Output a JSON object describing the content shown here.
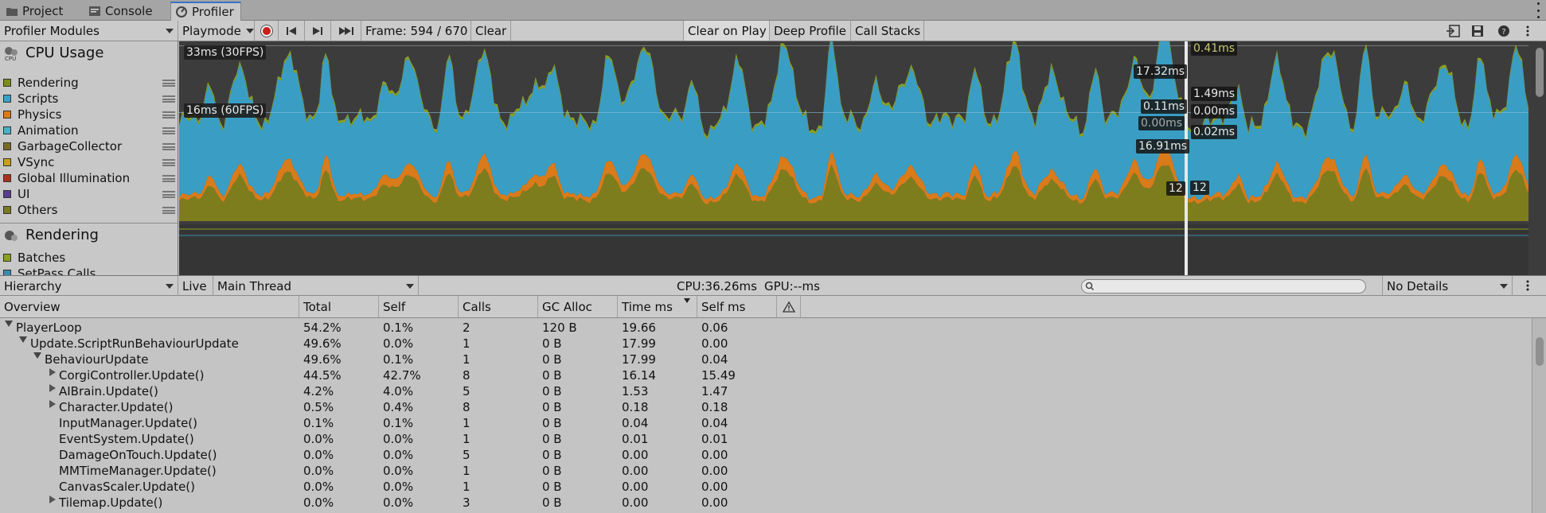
{
  "tabs": [
    {
      "label": "Project",
      "icon": "folder-icon"
    },
    {
      "label": "Console",
      "icon": "console-icon"
    },
    {
      "label": "Profiler",
      "icon": "profiler-icon",
      "active": true
    }
  ],
  "toolbar": {
    "modules_label": "Profiler Modules",
    "target_label": "Playmode",
    "frame_label": "Frame: 594 / 670",
    "clear_label": "Clear",
    "clear_on_play_label": "Clear on Play",
    "deep_profile_label": "Deep Profile",
    "call_stacks_label": "Call Stacks"
  },
  "modules": {
    "cpu": {
      "title": "CPU Usage",
      "legend": [
        {
          "label": "Rendering",
          "color": "#7d8c1e"
        },
        {
          "label": "Scripts",
          "color": "#3aa0c8"
        },
        {
          "label": "Physics",
          "color": "#d97b1a"
        },
        {
          "label": "Animation",
          "color": "#4ab0c8"
        },
        {
          "label": "GarbageCollector",
          "color": "#7a6a2a"
        },
        {
          "label": "VSync",
          "color": "#c8a018"
        },
        {
          "label": "Global Illumination",
          "color": "#a8321e"
        },
        {
          "label": "UI",
          "color": "#5a3c8c"
        },
        {
          "label": "Others",
          "color": "#7a7a22"
        }
      ]
    },
    "rendering": {
      "title": "Rendering",
      "legend": [
        {
          "label": "Batches",
          "color": "#8ca020"
        },
        {
          "label": "SetPass Calls",
          "color": "#3a8ab0"
        }
      ]
    }
  },
  "chart": {
    "line_30fps": "33ms (30FPS)",
    "line_60fps": "16ms (60FPS)",
    "readouts": {
      "top": "0.41ms",
      "scripts_left": "17.32ms",
      "scripts_right": "1.49ms",
      "physics_left": "0.11ms",
      "physics_right": "0.00ms",
      "gc_left": "0.00ms",
      "gc_right": "0.02ms",
      "rendering_left": "16.91ms",
      "batches_left": "12",
      "batches_right": "12"
    }
  },
  "status": {
    "view_label": "Hierarchy",
    "live_label": "Live",
    "thread_label": "Main Thread",
    "cpu_label": "CPU:36.26ms",
    "gpu_label": "GPU:--ms",
    "search_placeholder": "",
    "details_label": "No Details"
  },
  "table": {
    "columns": [
      "Overview",
      "Total",
      "Self",
      "Calls",
      "GC Alloc",
      "Time ms",
      "Self ms"
    ],
    "rows": [
      {
        "name": "PlayerLoop",
        "depth": 0,
        "fold": "open",
        "total": "54.2%",
        "self": "0.1%",
        "calls": "2",
        "gc": "120 B",
        "time": "19.66",
        "selfms": "0.06"
      },
      {
        "name": "Update.ScriptRunBehaviourUpdate",
        "depth": 1,
        "fold": "open",
        "total": "49.6%",
        "self": "0.0%",
        "calls": "1",
        "gc": "0 B",
        "time": "17.99",
        "selfms": "0.00"
      },
      {
        "name": "BehaviourUpdate",
        "depth": 2,
        "fold": "open",
        "total": "49.6%",
        "self": "0.1%",
        "calls": "1",
        "gc": "0 B",
        "time": "17.99",
        "selfms": "0.04"
      },
      {
        "name": "CorgiController.Update()",
        "depth": 3,
        "fold": "closed",
        "total": "44.5%",
        "self": "42.7%",
        "calls": "8",
        "gc": "0 B",
        "time": "16.14",
        "selfms": "15.49"
      },
      {
        "name": "AIBrain.Update()",
        "depth": 3,
        "fold": "closed",
        "total": "4.2%",
        "self": "4.0%",
        "calls": "5",
        "gc": "0 B",
        "time": "1.53",
        "selfms": "1.47"
      },
      {
        "name": "Character.Update()",
        "depth": 3,
        "fold": "closed",
        "total": "0.5%",
        "self": "0.4%",
        "calls": "8",
        "gc": "0 B",
        "time": "0.18",
        "selfms": "0.18"
      },
      {
        "name": "InputManager.Update()",
        "depth": 3,
        "fold": "none",
        "total": "0.1%",
        "self": "0.1%",
        "calls": "1",
        "gc": "0 B",
        "time": "0.04",
        "selfms": "0.04"
      },
      {
        "name": "EventSystem.Update()",
        "depth": 3,
        "fold": "none",
        "total": "0.0%",
        "self": "0.0%",
        "calls": "1",
        "gc": "0 B",
        "time": "0.01",
        "selfms": "0.01"
      },
      {
        "name": "DamageOnTouch.Update()",
        "depth": 3,
        "fold": "none",
        "total": "0.0%",
        "self": "0.0%",
        "calls": "5",
        "gc": "0 B",
        "time": "0.00",
        "selfms": "0.00"
      },
      {
        "name": "MMTimeManager.Update()",
        "depth": 3,
        "fold": "none",
        "total": "0.0%",
        "self": "0.0%",
        "calls": "1",
        "gc": "0 B",
        "time": "0.00",
        "selfms": "0.00"
      },
      {
        "name": "CanvasScaler.Update()",
        "depth": 3,
        "fold": "none",
        "total": "0.0%",
        "self": "0.0%",
        "calls": "1",
        "gc": "0 B",
        "time": "0.00",
        "selfms": "0.00"
      },
      {
        "name": "Tilemap.Update()",
        "depth": 3,
        "fold": "closed",
        "total": "0.0%",
        "self": "0.0%",
        "calls": "3",
        "gc": "0 B",
        "time": "0.00",
        "selfms": "0.00"
      }
    ]
  }
}
